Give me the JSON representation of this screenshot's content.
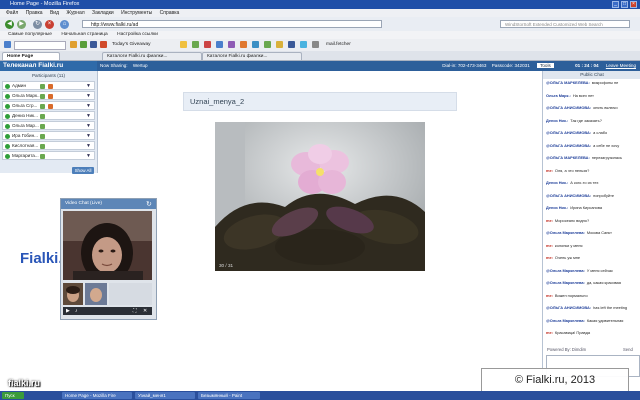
{
  "window": {
    "title": "Home Page - Mozilla Firefox"
  },
  "menu": [
    "Файл",
    "Правка",
    "Вид",
    "Журнал",
    "Закладки",
    "Инструменты",
    "Справка"
  ],
  "address": {
    "url": "http://www.fialki.ru/ad"
  },
  "search": {
    "placeholder": "WindStorSoft Extended Customized Web Search"
  },
  "bookmarks": [
    "Самые популярные",
    "Начальная страница",
    "Настройка ссылки"
  ],
  "toolbar2": {
    "item1": "Today's Giveaway",
    "item2": "mail.fetcher"
  },
  "tabs": [
    {
      "label": "Home Page"
    },
    {
      "label": "Каталоги Fialki.ru фиалки..."
    },
    {
      "label": "Каталоги Fialki.ru фиалки..."
    }
  ],
  "site": {
    "brand": "Телеканал Fialki.ru",
    "now_sharing": "Now Sharing:",
    "whoami": "Wertup",
    "dialin_label": "Dial-in:",
    "dialin": "702-473-3463",
    "passcode_label": "Passcode:",
    "passcode": "342031",
    "tools": "Tools",
    "timer": "01 : 24 : 04",
    "leave": "Leave Meeting"
  },
  "participants": {
    "title": "Participants (11)",
    "show_all": "Show All",
    "rows": [
      "Админ",
      "Ольга Марк...",
      "Ольга Сгр...",
      "Дениз Ник...",
      "Ольга Мар...",
      "Ира Гобин...",
      "Кислотная...",
      "Маргарита..."
    ]
  },
  "video_chat": {
    "title": "Video Chat (Live)"
  },
  "share": {
    "title": "Uznai_menya_2",
    "counter": "30 / 31"
  },
  "chat": {
    "title": "Public Chat",
    "powered": "Powered By: Dimdim",
    "send": "Send",
    "messages": [
      {
        "who": "@ОЛЬГА МАРКЕЛЕВА:",
        "text": "микрофоны не",
        "red": false
      },
      {
        "who": "Ольга Марк.:",
        "text": "На всех нет",
        "red": false
      },
      {
        "who": "@ОЛЬГА АНИСИМОВА:",
        "text": "опять включи",
        "red": false
      },
      {
        "who": "Дениз Ник.:",
        "text": "Так где заказать?",
        "red": false
      },
      {
        "who": "@ОЛЬГА АНИСИМОВА:",
        "text": "а слабо",
        "red": false
      },
      {
        "who": "@ОЛЬГА АНИСИМОВА:",
        "text": "а себе не хочу",
        "red": false
      },
      {
        "who": "@ОЛЬГА МАРКЕЛЕВА:",
        "text": "перезагрузилась",
        "red": false
      },
      {
        "who": "me:",
        "text": "Оля, а что нельзя?",
        "red": true
      },
      {
        "who": "Дениз Ник.:",
        "text": "А кого-то из тех",
        "red": false
      },
      {
        "who": "@ОЛЬГА АНИСИМОВА:",
        "text": "попробуйте",
        "red": false
      },
      {
        "who": "Дениз Ник.:",
        "text": "Ирина Кирсанова",
        "red": false
      },
      {
        "who": "me:",
        "text": "Моросеанс видно?",
        "red": true
      },
      {
        "who": "@Ольга Маркелева:",
        "text": "Москва Санкт",
        "red": false
      },
      {
        "who": "me:",
        "text": "колонки у меня",
        "red": true
      },
      {
        "who": "me:",
        "text": "Очень уж мне",
        "red": true
      },
      {
        "who": "@Ольга Маркелева:",
        "text": "У меня сейчас",
        "red": false
      },
      {
        "who": "@Ольга Маркелева:",
        "text": "да, какая красивая",
        "red": false
      },
      {
        "who": "me:",
        "text": "Вижен нормально",
        "red": true
      },
      {
        "who": "@ОЛЬГА АНИСИМОВА:",
        "text": "has left the meeting",
        "red": false
      },
      {
        "who": "@Ольга Маркелева:",
        "text": "Какая удивительная",
        "red": false
      },
      {
        "who": "me:",
        "text": "Красавица! Правда",
        "red": true
      }
    ]
  },
  "taskbar": {
    "start": "Пуск",
    "items": [
      "Home Page - Mozilla Fire",
      "Узнай_меня1",
      "Безымянный - Paint"
    ]
  },
  "watermark": {
    "brand": "fialki.ru",
    "site": "Fialki.ru",
    "copyright": "© Fialki.ru, 2013"
  }
}
